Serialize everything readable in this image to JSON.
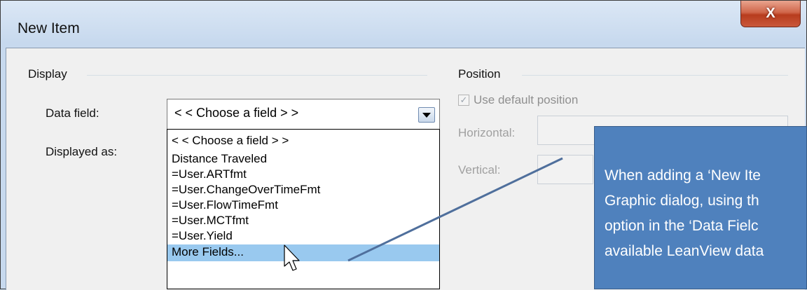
{
  "window": {
    "title": "New Item",
    "close_label": "X"
  },
  "display_group": {
    "title": "Display",
    "data_field_label": "Data field:",
    "displayed_as_label": "Displayed as:",
    "combo_value": "< < Choose a field > >",
    "options": [
      "< < Choose a field > >",
      "Distance Traveled",
      "=User.ARTfmt",
      "=User.ChangeOverTimeFmt",
      "=User.FlowTimeFmt",
      "=User.MCTfmt",
      "=User.Yield",
      "More Fields..."
    ],
    "selected_index": 7
  },
  "position_group": {
    "title": "Position",
    "default_checkbox_label": "Use default position",
    "default_checked": true,
    "horizontal_label": "Horizontal:",
    "vertical_label": "Vertical:"
  },
  "callout": {
    "line1": "When adding a ‘New Ite",
    "line2": "Graphic dialog, using th",
    "line3": "option in the ‘Data Fielc",
    "line4": "available LeanView data"
  },
  "colors": {
    "callout_bg": "#4f81bd",
    "selection": "#99c9ef",
    "close_button": "#c9583b"
  }
}
